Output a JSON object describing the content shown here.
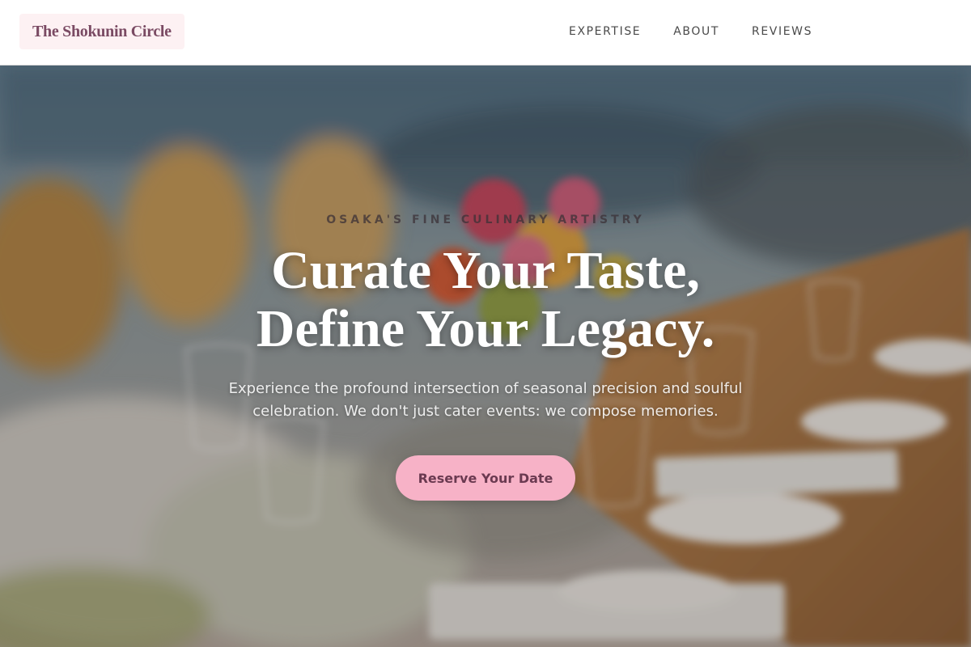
{
  "header": {
    "logo": "The Shokunin Circle",
    "nav": [
      "EXPERTISE",
      "ABOUT",
      "REVIEWS"
    ]
  },
  "hero": {
    "eyebrow": "OSAKA'S FINE CULINARY ARTISTRY",
    "title_line1": "Curate Your Taste,",
    "title_line2": "Define Your Legacy.",
    "subtitle": "Experience the profound intersection of seasonal precision and soulful celebration. We don't just cater events: we compose memories.",
    "cta_label": "Reserve Your Date",
    "image": "banquet-table-photo"
  },
  "colors": {
    "accent": "#f7b2c7",
    "accent_text": "#6b3a51",
    "logo_text": "#7a4a63",
    "logo_bg": "#fdf1f3"
  }
}
